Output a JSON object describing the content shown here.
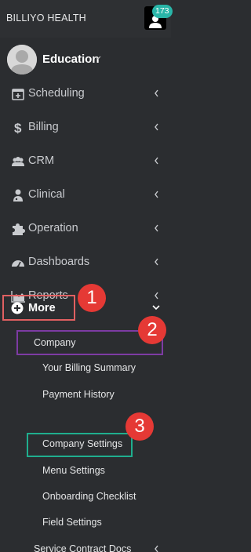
{
  "header": {
    "brand": "BILLIYO HEALTH",
    "notification_count": "173"
  },
  "profile": {
    "organization": "Education"
  },
  "menu": [
    {
      "label": "Scheduling",
      "icon": "calendar-plus-icon"
    },
    {
      "label": "Billing",
      "icon": "dollar-icon"
    },
    {
      "label": "CRM",
      "icon": "users-icon"
    },
    {
      "label": "Clinical",
      "icon": "user-doctor-icon"
    },
    {
      "label": "Operation",
      "icon": "puzzle-icon"
    },
    {
      "label": "Dashboards",
      "icon": "gauge-icon"
    },
    {
      "label": "Reports",
      "icon": "area-chart-icon"
    }
  ],
  "more": {
    "label": "More",
    "icon": "plus-circle-icon"
  },
  "submenu": {
    "company": "Company",
    "items": [
      "Your Billing Summary",
      "Payment History",
      "Company Settings",
      "Menu Settings",
      "Onboarding Checklist",
      "Field Settings"
    ],
    "service_contract_docs": "Service Contract Docs"
  },
  "annotations": [
    "1",
    "2",
    "3"
  ],
  "colors": {
    "sidebar_bg": "#2b2d30",
    "badge": "#29b5a8",
    "marker_red": "#e53935",
    "box_more": "#e06061",
    "box_company": "#7d3ba3",
    "box_company_settings": "#1fae8e"
  }
}
